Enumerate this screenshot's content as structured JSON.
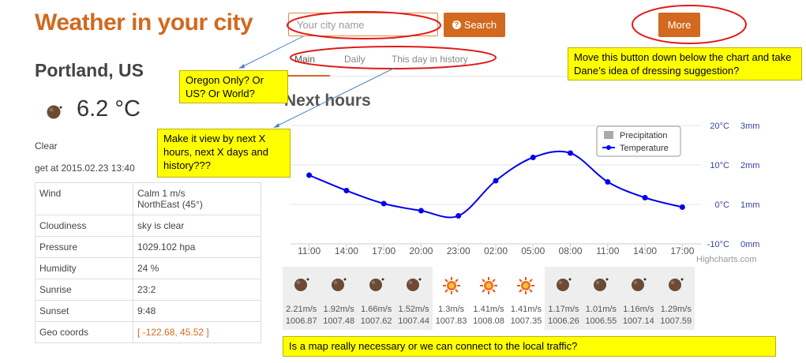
{
  "header": {
    "title": "Weather in your city",
    "search_placeholder": "Your city name",
    "search_label": "Search",
    "more_label": "More"
  },
  "location": {
    "city": "Portland, US",
    "temperature": "6.2 °C",
    "condition": "Clear",
    "updated": "get at 2015.02.23 13:40"
  },
  "details": [
    {
      "label": "Wind",
      "value": "Calm 1 m/s",
      "value2": "NorthEast (45°)"
    },
    {
      "label": "Cloudiness",
      "value": "sky is clear"
    },
    {
      "label": "Pressure",
      "value": "1029.102 hpa"
    },
    {
      "label": "Humidity",
      "value": "24 %"
    },
    {
      "label": "Sunrise",
      "value": "23:2"
    },
    {
      "label": "Sunset",
      "value": "9:48"
    },
    {
      "label": "Geo coords",
      "value": "[ -122.68, 45.52 ]"
    }
  ],
  "tabs": [
    "Main",
    "Daily",
    "This day in history"
  ],
  "section_title": "Next hours",
  "chart_data": {
    "type": "line",
    "categories": [
      "11:00",
      "14:00",
      "17:00",
      "20:00",
      "23:00",
      "02:00",
      "05:00",
      "08:00",
      "11:00",
      "14:00",
      "17:00"
    ],
    "series": [
      {
        "name": "Temperature",
        "values": [
          7.4,
          3.5,
          0.2,
          -1.6,
          -2.9,
          6.0,
          11.9,
          13.0,
          5.7,
          1.7,
          -0.7
        ]
      },
      {
        "name": "Precipitation",
        "values": []
      }
    ],
    "y_left_ticks": [
      "-10°C",
      "0°C",
      "10°C",
      "20°C"
    ],
    "y_right_ticks": [
      "0mm",
      "1mm",
      "2mm",
      "3mm"
    ],
    "ylim": [
      -10,
      20
    ],
    "legend": "top-right",
    "credits": "Highcharts.com",
    "colors": {
      "temperature": "#0000ee",
      "precipitation": "#aaaaaa",
      "accent": "#d2691e"
    }
  },
  "forecast": [
    {
      "icon": "moon-icon",
      "wind": "2.21m/s",
      "pressure": "1006.87"
    },
    {
      "icon": "moon-icon",
      "wind": "1.92m/s",
      "pressure": "1007.48"
    },
    {
      "icon": "moon-icon",
      "wind": "1.66m/s",
      "pressure": "1007.62"
    },
    {
      "icon": "moon-icon",
      "wind": "1.52m/s",
      "pressure": "1007.44"
    },
    {
      "icon": "sun-icon",
      "wind": "1.3m/s",
      "pressure": "1007.83"
    },
    {
      "icon": "sun-icon",
      "wind": "1.41m/s",
      "pressure": "1008.08"
    },
    {
      "icon": "sun-icon",
      "wind": "1.41m/s",
      "pressure": "1007.35"
    },
    {
      "icon": "moon-icon",
      "wind": "1.17m/s",
      "pressure": "1006.26"
    },
    {
      "icon": "moon-icon",
      "wind": "1.01m/s",
      "pressure": "1006.55"
    },
    {
      "icon": "moon-icon",
      "wind": "1.16m/s",
      "pressure": "1007.14"
    },
    {
      "icon": "moon-icon",
      "wind": "1.29m/s",
      "pressure": "1007.59"
    }
  ],
  "notes": {
    "oregon": "Oregon Only? Or US? Or World?",
    "view": "Make it view by next X hours, next X days and history???",
    "more": "Move this button down below the chart and take Dane’s idea of dressing suggestion?",
    "map": "Is a map really necessary or we can connect to the local traffic?"
  }
}
